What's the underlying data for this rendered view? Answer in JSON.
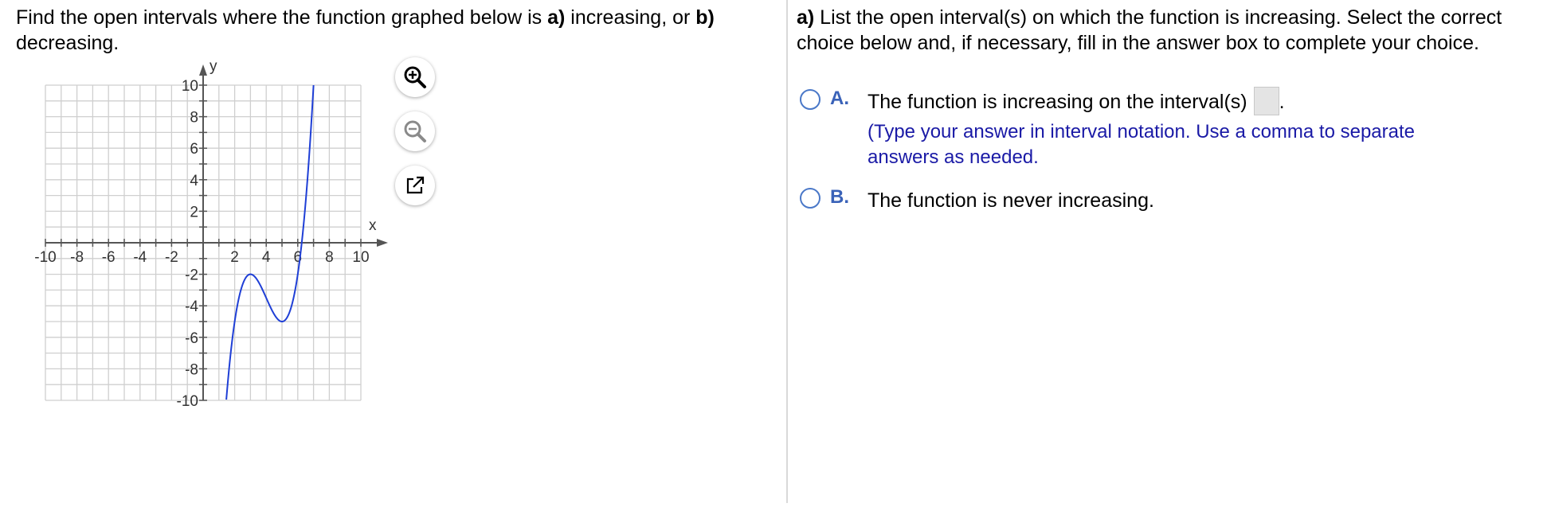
{
  "question": {
    "part1": "Find the open intervals where the function graphed below is ",
    "a_label": "a)",
    "part2": " increasing, or ",
    "b_label": "b)",
    "part3": " decreasing."
  },
  "graph": {
    "x_axis_label": "x",
    "y_axis_label": "y",
    "x_tick_labels": [
      "-10",
      "-8",
      "-6",
      "-4",
      "-2",
      "2",
      "4",
      "6",
      "8",
      "10"
    ],
    "y_tick_labels": [
      "10",
      "8",
      "6",
      "4",
      "2",
      "-2",
      "-4",
      "-6",
      "-8",
      "-10"
    ],
    "xlim": [
      -10,
      10
    ],
    "ylim": [
      -10,
      10
    ],
    "curve_color": "#1f3fd6",
    "grid_color": "#cfcfcf",
    "local_max": [
      3,
      -2
    ],
    "local_min": [
      5,
      -5
    ],
    "icons": [
      "zoom-in-icon",
      "zoom-out-icon",
      "open-new-window-icon"
    ]
  },
  "part_a": {
    "prompt_bold": "a)",
    "prompt": " List the open interval(s) on which the function is increasing. Select the correct choice below and, if necessary, fill in the answer box to complete your choice.",
    "choice_a_letter": "A.",
    "choice_a_text": "The function is increasing on the interval(s)",
    "choice_a_period": ".",
    "choice_a_hint": "(Type your answer in interval notation. Use a comma to separate answers as needed.",
    "choice_b_letter": "B.",
    "choice_b_text": "The function is never increasing.",
    "accent_color": "#3a62b8"
  }
}
